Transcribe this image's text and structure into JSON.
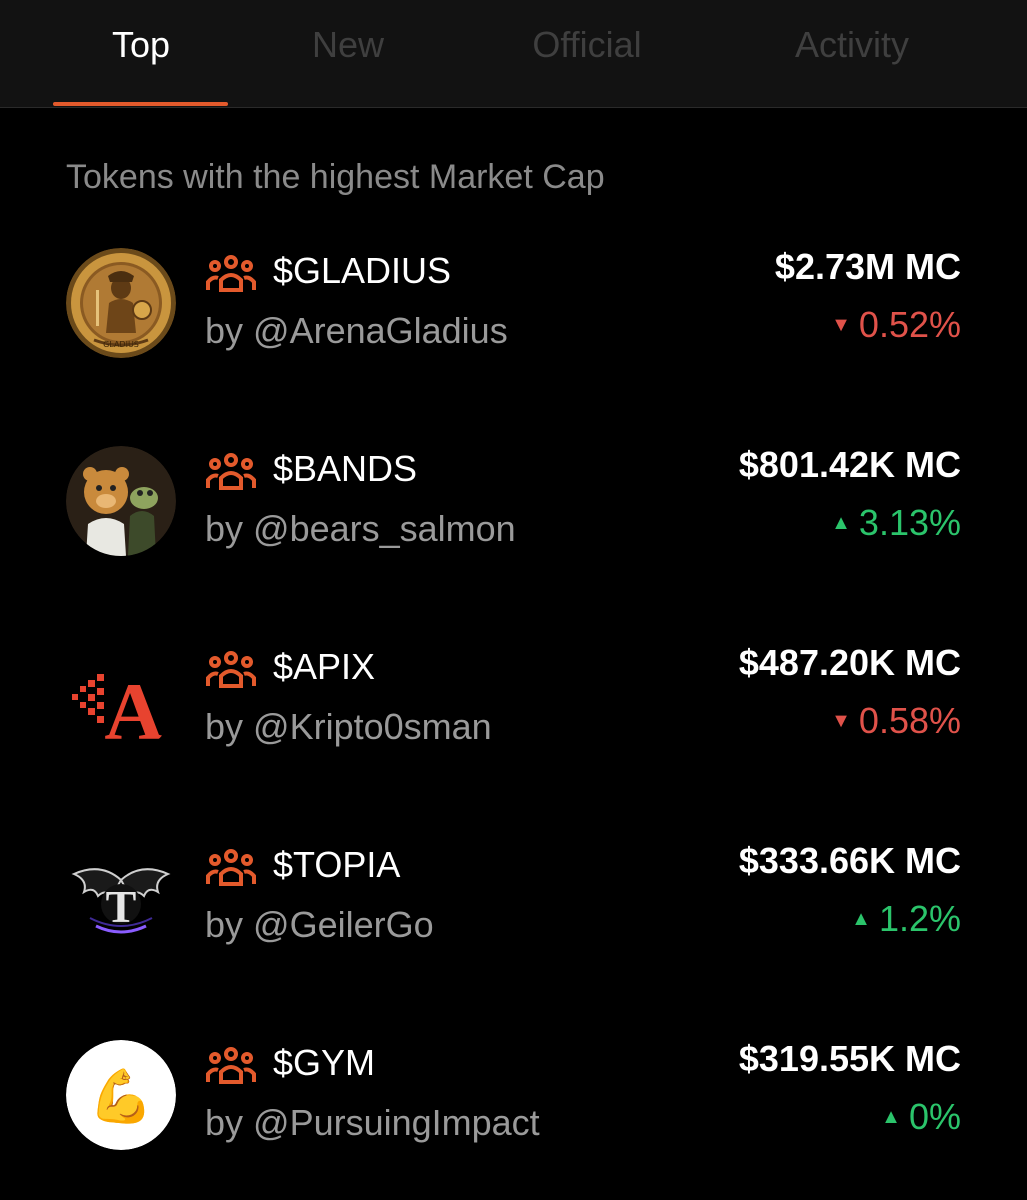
{
  "tabs": [
    {
      "label": "Top"
    },
    {
      "label": "New"
    },
    {
      "label": "Official"
    },
    {
      "label": "Activity"
    }
  ],
  "subtitle": "Tokens with the highest Market Cap",
  "colors": {
    "accent": "#e35a2c",
    "down": "#e0524a",
    "up": "#2bc46b",
    "muted": "#9a9a9a"
  },
  "tokens": [
    {
      "ticker": "$GLADIUS",
      "creator": "by @ArenaGladius",
      "market_cap": "$2.73M MC",
      "change": "0.52%",
      "direction": "down",
      "avatar_text": "GLADIUS"
    },
    {
      "ticker": "$BANDS",
      "creator": "by @bears_salmon",
      "market_cap": "$801.42K MC",
      "change": "3.13%",
      "direction": "up"
    },
    {
      "ticker": "$APIX",
      "creator": "by @Kripto0sman",
      "market_cap": "$487.20K MC",
      "change": "0.58%",
      "direction": "down",
      "avatar_text": "A"
    },
    {
      "ticker": "$TOPIA",
      "creator": "by @GeilerGo",
      "market_cap": "$333.66K MC",
      "change": "1.2%",
      "direction": "up",
      "avatar_text": "T"
    },
    {
      "ticker": "$GYM",
      "creator": "by @PursuingImpact",
      "market_cap": "$319.55K MC",
      "change": "0%",
      "direction": "up",
      "avatar_text": "💪"
    }
  ]
}
